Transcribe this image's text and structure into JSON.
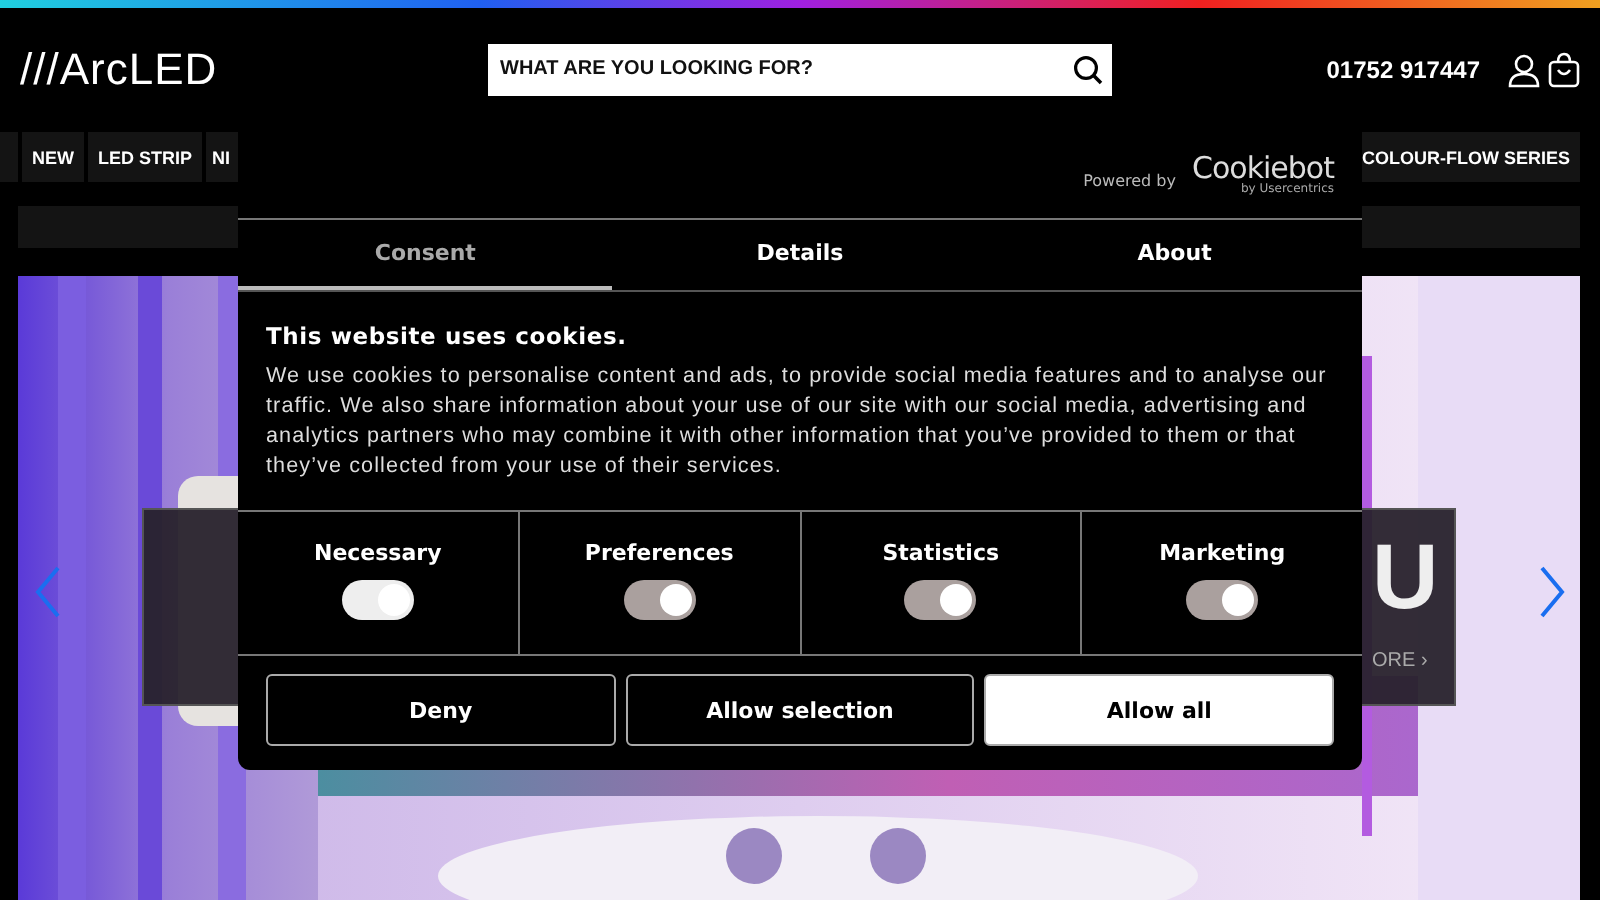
{
  "header": {
    "logo": "///ArcLED",
    "search": {
      "placeholder": "WHAT ARE YOU LOOKING FOR?"
    },
    "phone": "01752 917447"
  },
  "nav": {
    "items": [
      {
        "label": "NEW"
      },
      {
        "label": "LED STRIP"
      },
      {
        "label": "NI"
      }
    ],
    "right_item": "COLOUR-FLOW SERIES"
  },
  "hero": {
    "kind": "picture",
    "headline": "U",
    "link": "ORE ›"
  },
  "cookie_dialog": {
    "powered_by": "Powered by",
    "brand": "Cookiebot",
    "brand_sub": "by Usercentrics",
    "tabs": [
      {
        "label": "Consent",
        "selected": true
      },
      {
        "label": "Details",
        "selected": false
      },
      {
        "label": "About",
        "selected": false
      }
    ],
    "title": "This website uses cookies.",
    "text": "We use cookies to personalise content and ads, to provide social media features and to analyse our traffic. We also share information about your use of our site with our social media, advertising and analytics partners who may combine it with other information that you’ve provided to them or that they’ve collected from your use of their services.",
    "categories": [
      {
        "label": "Necessary",
        "checked": true,
        "disabled": true
      },
      {
        "label": "Preferences",
        "checked": true,
        "disabled": false
      },
      {
        "label": "Statistics",
        "checked": true,
        "disabled": false
      },
      {
        "label": "Marketing",
        "checked": true,
        "disabled": false
      }
    ],
    "buttons": [
      {
        "label": "Deny",
        "kind": "outline"
      },
      {
        "label": "Allow selection",
        "kind": "outline"
      },
      {
        "label": "Allow all",
        "kind": "filled"
      }
    ]
  }
}
